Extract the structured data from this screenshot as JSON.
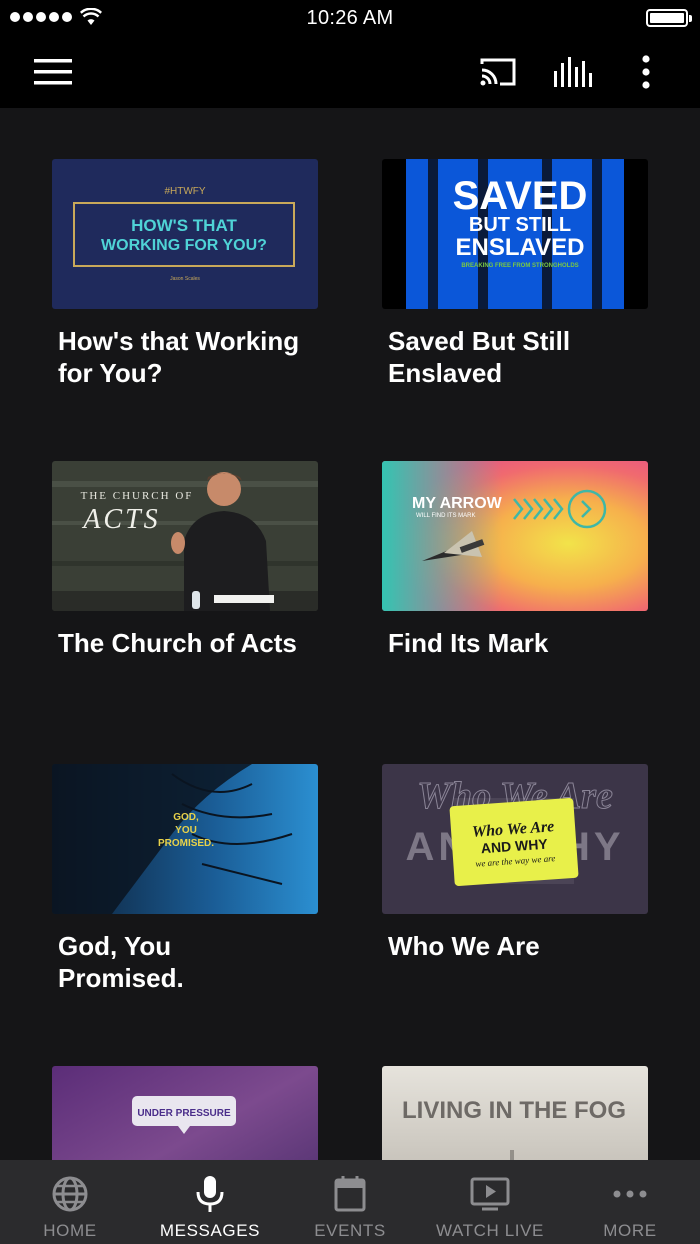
{
  "status_bar": {
    "time": "10:26 AM"
  },
  "nav_bar": {
    "menu_icon": "hamburger-menu-icon",
    "cast_icon": "cast-icon",
    "equalizer_icon": "audio-bars-icon",
    "more_icon": "vertical-ellipsis-icon"
  },
  "messages": [
    {
      "title": "How's that Working for You?",
      "thumb": {
        "hashtag": "#HTWFY",
        "line1": "HOW'S THAT",
        "line2": "WORKING FOR YOU?",
        "credit": "Jason Scales",
        "colors": {
          "bg": "#1f2a5c",
          "accent": "#4fd3d6",
          "frame": "#c9a95a"
        }
      }
    },
    {
      "title": "Saved But Still Enslaved",
      "thumb": {
        "line1": "SAVED",
        "line2": "BUT STILL",
        "line3": "ENSLAVED",
        "tagline": "BREAKING FREE FROM STRONGHOLDS",
        "colors": {
          "bg": "#0b57d9",
          "accent": "#7ac943"
        }
      }
    },
    {
      "title": "The Church of Acts",
      "thumb": {
        "line1": "THE CHURCH OF",
        "line2": "ACTS",
        "colors": {
          "bg": "#3a3f36"
        }
      }
    },
    {
      "title": "Find Its Mark",
      "thumb": {
        "line1": "MY ARROW",
        "line2": "WILL FIND ITS MARK",
        "colors": {
          "bg": "#f2a55e",
          "accent": "#34c4b2"
        }
      }
    },
    {
      "title": "God, You Promised.",
      "thumb": {
        "line1": "GOD,",
        "line2": "YOU",
        "line3": "PROMISED.",
        "colors": {
          "bg": "#1d6fb8",
          "accent": "#e8d24a"
        }
      }
    },
    {
      "title": "Who We Are",
      "thumb": {
        "line1": "Who We Are",
        "line2": "AND WHY",
        "line3": "we are the way we are",
        "colors": {
          "bg": "#3c3548",
          "accent": "#e8f04a"
        }
      }
    },
    {
      "title": "",
      "thumb": {
        "line1": "UNDER PRESSURE",
        "colors": {
          "bg": "#6a3a8a"
        }
      }
    },
    {
      "title": "",
      "thumb": {
        "line1": "LIVING IN THE FOG",
        "colors": {
          "bg": "#cfcbc3"
        }
      }
    }
  ],
  "tab_bar": {
    "items": [
      {
        "label": "HOME",
        "icon": "globe-icon",
        "active": false
      },
      {
        "label": "MESSAGES",
        "icon": "microphone-icon",
        "active": true
      },
      {
        "label": "EVENTS",
        "icon": "calendar-icon",
        "active": false
      },
      {
        "label": "WATCH LIVE",
        "icon": "tv-play-icon",
        "active": false
      },
      {
        "label": "MORE",
        "icon": "horizontal-ellipsis-icon",
        "active": false
      }
    ]
  }
}
